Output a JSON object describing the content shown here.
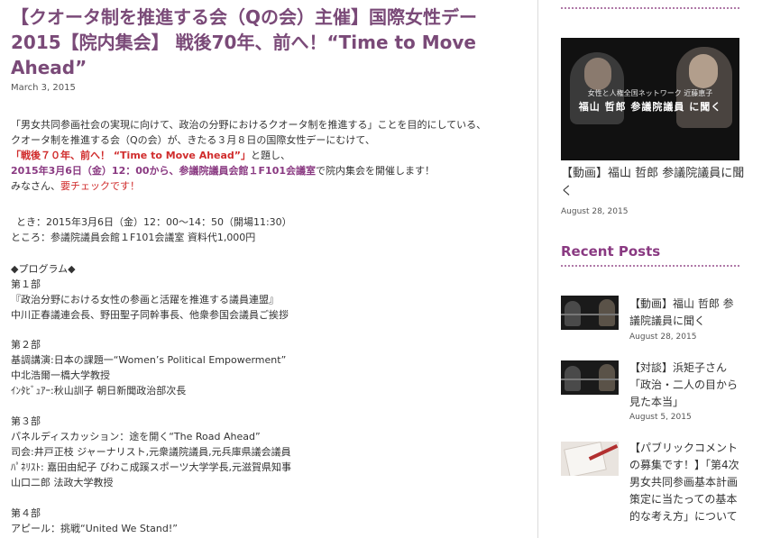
{
  "article": {
    "title": "【クオータ制を推進する会（Qの会）主催】国際女性デー2015【院内集会】 戦後70年、前へ！“Time to Move Ahead”",
    "date": "March 3, 2015",
    "intro_1": "「男女共同参画社会の実現に向けて、政治の分野におけるクオータ制を推進する」ことを目的にしている、",
    "intro_2": "クオータ制を推進する会（Qの会）が、きたる３月８日の国際女性デーにむけて、",
    "intro_3_highlight": "「戦後７０年、前へ！ “Time to Move Ahead”」",
    "intro_3_rest": "と題し、",
    "intro_4_highlight": "2015年3月6日（金）12：00から、参議院議員会館１F101会議室",
    "intro_4_rest": "で院内集会を開催します！",
    "intro_5_plain": "みなさん、",
    "intro_5_red": "要チェックです！",
    "when": "とき：2015年3月6日（金）12：00〜14：50（開場11:30）",
    "where": "ところ：参議院議員会館１F101会議室 資料代1,000円",
    "program_heading": "◆プログラム◆",
    "part1_title": "第１部",
    "part1_line1": "『政治分野における女性の参画と活躍を推進する議員連盟』",
    "part1_line2": "中川正春議連会長、野田聖子同幹事長、他衆参国会議員ご挨拶",
    "part2_title": "第２部",
    "part2_line1": "基調講演:日本の課題一“Women’s Political Empowerment”",
    "part2_line2": "中北浩爾一橋大学教授",
    "part2_line3": "ｲﾝﾀﾋﾞｭｱｰ:秋山訓子 朝日新聞政治部次長",
    "part3_title": "第３部",
    "part3_line1": "パネルディスカッション：途を開く“The Road Ahead”",
    "part3_line2": "司会:井戸正枝 ジャーナリスト,元衆議院議員,元兵庫県議会議員",
    "part3_line3": "ﾊﾟﾈﾘｽﾄ: 嘉田由紀子 びわこ成蹊スポーツ大学学長,元滋賀県知事",
    "part3_line4": "山口二郎 法政大学教授",
    "part4_title": "第４部",
    "part4_line1": "アピール：挑戦“United We Stand!”"
  },
  "sidebar": {
    "featured": {
      "video_caption_1": "女性と人権全国ネットワーク 近藤恵子",
      "video_caption_2": "福山 哲郎 参議院議員 に聞く",
      "title": "【動画】福山 哲郎 参議院議員に聞く",
      "date": "August 28, 2015"
    },
    "recent_heading": "Recent Posts",
    "posts": [
      {
        "title": "【動画】福山 哲郎 参議院議員に聞く",
        "date": "August 28, 2015"
      },
      {
        "title": "【対談】浜矩子さん「政治・二人の目から見た本当」",
        "date": "August 5, 2015"
      },
      {
        "title": "【パブリックコメントの募集です！】「第4次男女共同参画基本計画策定に当たっての基本的な考え方」について",
        "date": ""
      }
    ]
  },
  "colors": {
    "accent": "#8a3a82",
    "title": "#7a4a78",
    "highlight_red": "#d02c2c"
  }
}
